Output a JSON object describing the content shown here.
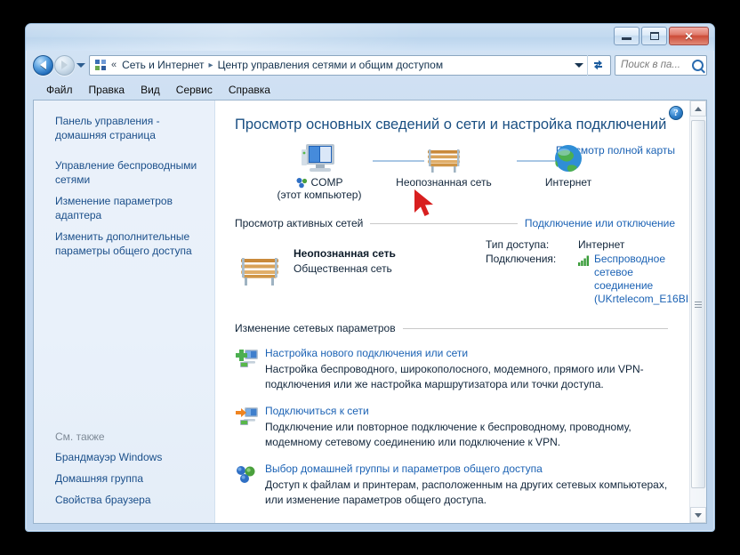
{
  "window": {
    "minimize_label": "Свернуть",
    "maximize_label": "Развернуть",
    "close_label": "Закрыть"
  },
  "nav": {
    "back_label": "Назад",
    "forward_label": "Вперед",
    "history_label": "Последние страницы",
    "refresh_label": "Обновить",
    "breadcrumb_icon": "control-panel-icon",
    "chevrons": "«",
    "crumbs": [
      "Сеть и Интернет",
      "Центр управления сетями и общим доступом"
    ],
    "separator": "▸"
  },
  "search": {
    "placeholder": "Поиск в па...",
    "value": ""
  },
  "menubar": {
    "items": [
      "Файл",
      "Правка",
      "Вид",
      "Сервис",
      "Справка"
    ]
  },
  "sidebar": {
    "items": [
      "Панель управления - домашняя страница",
      "Управление беспроводными сетями",
      "Изменение параметров адаптера",
      "Изменить дополнительные параметры общего доступа"
    ],
    "see_also_title": "См. также",
    "see_also_items": [
      "Брандмауэр Windows",
      "Домашняя группа",
      "Свойства браузера"
    ]
  },
  "content": {
    "help_glyph": "?",
    "heading": "Просмотр основных сведений о сети и настройка подключений",
    "full_map_link": "Просмотр полной карты",
    "map": {
      "computer_name": "COMP",
      "computer_sub": "(этот компьютер)",
      "network_name": "Неопознанная сеть",
      "internet_name": "Интернет"
    },
    "active_networks": {
      "section_title": "Просмотр активных сетей",
      "section_link": "Подключение или отключение",
      "network_name": "Неопознанная сеть",
      "network_type": "Общественная сеть",
      "access_key": "Тип доступа:",
      "access_value": "Интернет",
      "connections_key": "Подключения:",
      "connections_value": "Беспроводное сетевое соединение (UKrtelecom_E16BI"
    },
    "change_settings": {
      "section_title": "Изменение сетевых параметров",
      "items": [
        {
          "icon": "new-connection-icon",
          "title": "Настройка нового подключения или сети",
          "desc": "Настройка беспроводного, широкополосного, модемного, прямого или VPN-подключения или же настройка маршрутизатора или точки доступа."
        },
        {
          "icon": "connect-to-network-icon",
          "title": "Подключиться к сети",
          "desc": "Подключение или повторное подключение к беспроводному, проводному, модемному сетевому соединению или подключение к VPN."
        },
        {
          "icon": "homegroup-icon",
          "title": "Выбор домашней группы и параметров общего доступа",
          "desc": "Доступ к файлам и принтерам, расположенным на других сетевых компьютерах, или изменение параметров общего доступа."
        }
      ]
    }
  },
  "colors": {
    "link": "#1b62b4",
    "heading": "#1a4f82",
    "sidebar_link": "#1b4f8a",
    "chrome": "#c7daf0",
    "close_button": "#cd4b38",
    "cursor": "#d81f1f"
  }
}
